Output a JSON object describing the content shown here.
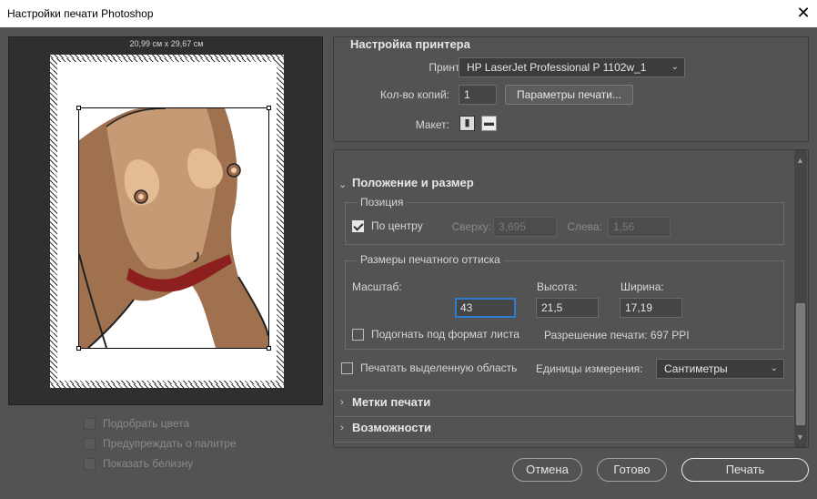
{
  "window": {
    "title": "Настройки печати Photoshop",
    "close_glyph": "✕"
  },
  "preview": {
    "dimensions": "20,99 см x 29,67 см"
  },
  "left_options": {
    "match_colors": "Подобрать цвета",
    "gamut_warning": "Предупреждать о палитре",
    "show_paper_white": "Показать белизну"
  },
  "printer_setup": {
    "title": "Настройка принтера",
    "printer_label": "Принтер:",
    "printer_value": "HP LaserJet Professional P 1102w_1",
    "copies_label": "Кол-во копий:",
    "copies_value": "1",
    "print_settings_button": "Параметры печати...",
    "layout_label": "Макет:"
  },
  "position_size": {
    "title": "Положение и размер",
    "position_group": "Позиция",
    "center_label": "По центру",
    "center_checked": true,
    "top_label": "Сверху:",
    "top_value": "3,695",
    "left_label": "Слева:",
    "left_value": "1,56",
    "scaled_group": "Размеры печатного оттиска",
    "scale_label": "Масштаб:",
    "scale_value": "43",
    "height_label": "Высота:",
    "height_value": "21,5",
    "width_label": "Ширина:",
    "width_value": "17,19",
    "fit_label": "Подогнать под формат листа",
    "resolution": "Разрешение печати: 697 PPI",
    "print_selected_label": "Печатать выделенную область",
    "units_label": "Единицы измерения:",
    "units_value": "Сантиметры"
  },
  "sections": {
    "print_marks": "Метки печати",
    "functions": "Возможности"
  },
  "footer": {
    "cancel": "Отмена",
    "done": "Готово",
    "print": "Печать"
  },
  "colors": {
    "accent_focus": "#2f7dd1",
    "background": "#535353"
  }
}
